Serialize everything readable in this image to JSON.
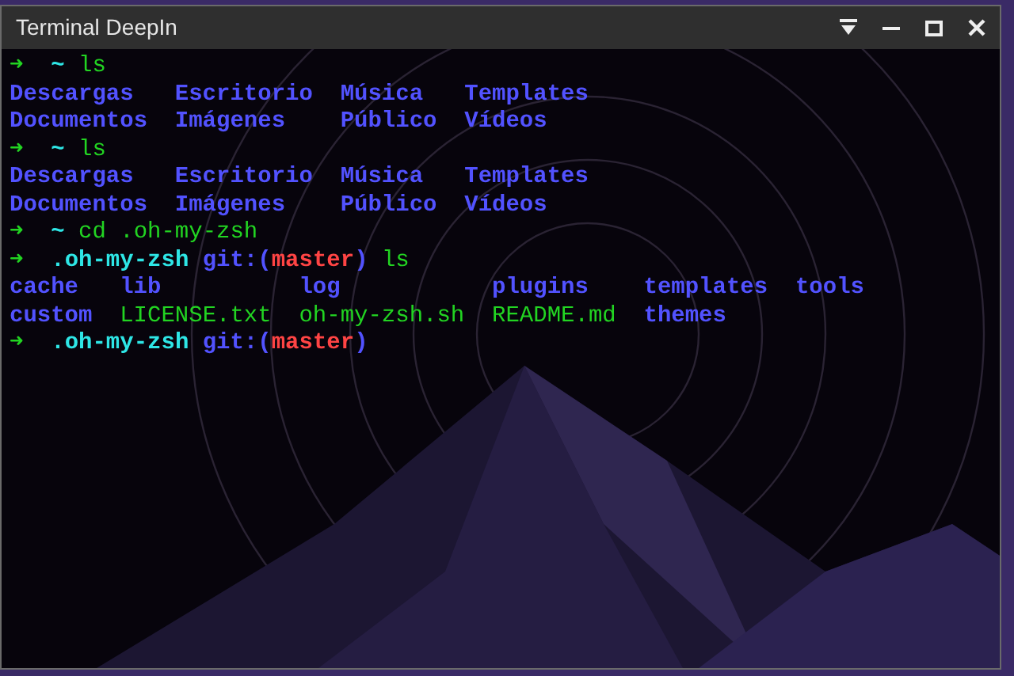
{
  "window": {
    "title": "Terminal DeepIn"
  },
  "terminal": {
    "blocks": [
      {
        "kind": "prompt",
        "segments": [
          {
            "kind": "arrow",
            "text": "➜"
          },
          {
            "kind": "cwd",
            "text": "~"
          },
          {
            "kind": "command",
            "text": "ls"
          }
        ]
      },
      {
        "kind": "listing",
        "rows": [
          [
            {
              "kind": "dir",
              "text": "Descargas"
            },
            {
              "kind": "dir",
              "text": "Escritorio"
            },
            {
              "kind": "dir",
              "text": "Música"
            },
            {
              "kind": "dir",
              "text": "Templates"
            }
          ],
          [
            {
              "kind": "dir",
              "text": "Documentos"
            },
            {
              "kind": "dir",
              "text": "Imágenes"
            },
            {
              "kind": "dir",
              "text": "Público"
            },
            {
              "kind": "dir",
              "text": "Vídeos"
            }
          ]
        ]
      },
      {
        "kind": "prompt",
        "segments": [
          {
            "kind": "arrow",
            "text": "➜"
          },
          {
            "kind": "cwd",
            "text": "~"
          },
          {
            "kind": "command",
            "text": "ls"
          }
        ]
      },
      {
        "kind": "listing",
        "rows": [
          [
            {
              "kind": "dir",
              "text": "Descargas"
            },
            {
              "kind": "dir",
              "text": "Escritorio"
            },
            {
              "kind": "dir",
              "text": "Música"
            },
            {
              "kind": "dir",
              "text": "Templates"
            }
          ],
          [
            {
              "kind": "dir",
              "text": "Documentos"
            },
            {
              "kind": "dir",
              "text": "Imágenes"
            },
            {
              "kind": "dir",
              "text": "Público"
            },
            {
              "kind": "dir",
              "text": "Vídeos"
            }
          ]
        ]
      },
      {
        "kind": "prompt",
        "segments": [
          {
            "kind": "arrow",
            "text": "➜"
          },
          {
            "kind": "cwd",
            "text": "~"
          },
          {
            "kind": "command",
            "text": "cd .oh-my-zsh"
          }
        ]
      },
      {
        "kind": "prompt",
        "segments": [
          {
            "kind": "arrow",
            "text": "➜"
          },
          {
            "kind": "cwd",
            "text": ".oh-my-zsh"
          },
          {
            "kind": "git_open",
            "text": "git:("
          },
          {
            "kind": "branch",
            "text": "master"
          },
          {
            "kind": "git_close",
            "text": ")"
          },
          {
            "kind": "command",
            "text": "ls"
          }
        ]
      },
      {
        "kind": "listing",
        "rows": [
          [
            {
              "kind": "dir",
              "text": "cache"
            },
            {
              "kind": "dir",
              "text": "lib"
            },
            {
              "kind": "dir",
              "text": "log"
            },
            {
              "kind": "dir",
              "text": "plugins"
            },
            {
              "kind": "dir",
              "text": "templates"
            },
            {
              "kind": "dir",
              "text": "tools"
            }
          ],
          [
            {
              "kind": "dir",
              "text": "custom"
            },
            {
              "kind": "file",
              "text": "LICENSE.txt"
            },
            {
              "kind": "file",
              "text": "oh-my-zsh.sh"
            },
            {
              "kind": "file",
              "text": "README.md"
            },
            {
              "kind": "dir",
              "text": "themes"
            }
          ]
        ]
      },
      {
        "kind": "prompt",
        "segments": [
          {
            "kind": "arrow",
            "text": "➜"
          },
          {
            "kind": "cwd",
            "text": ".oh-my-zsh"
          },
          {
            "kind": "git_open",
            "text": "git:("
          },
          {
            "kind": "branch",
            "text": "master"
          },
          {
            "kind": "git_close",
            "text": ")"
          }
        ]
      }
    ]
  }
}
